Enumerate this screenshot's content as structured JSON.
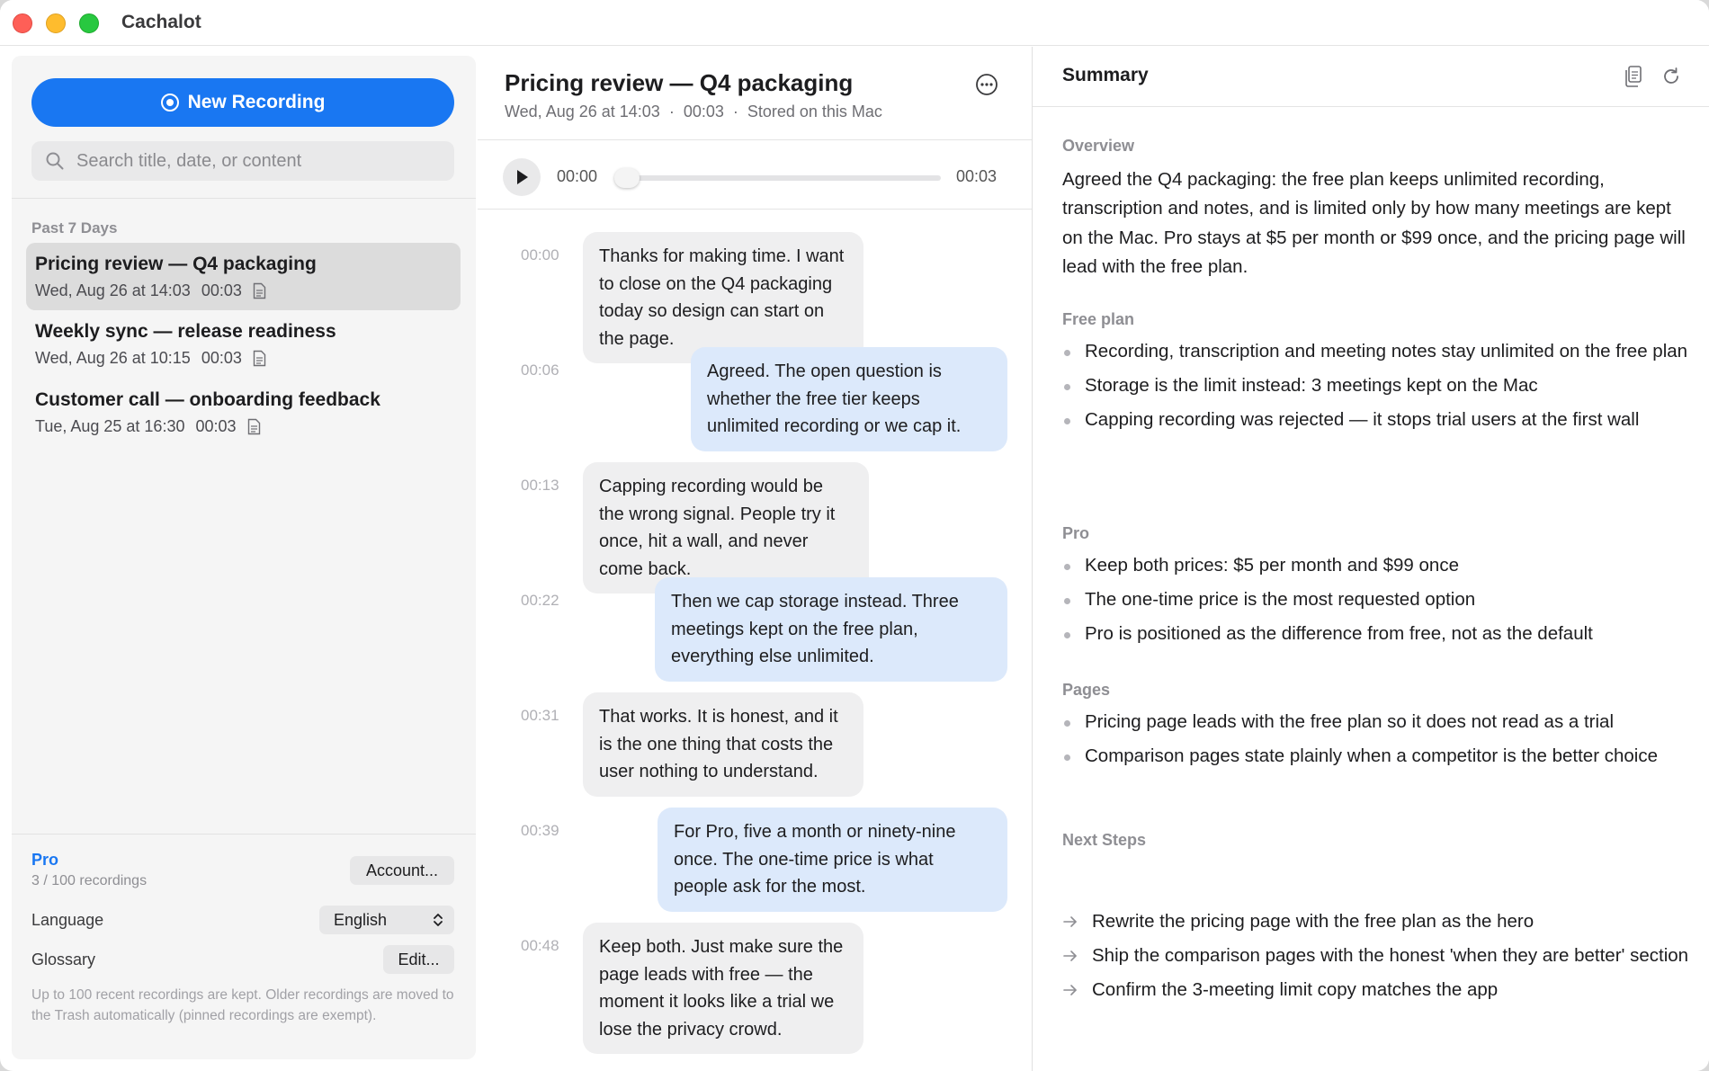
{
  "app": {
    "title": "Cachalot"
  },
  "sidebar": {
    "new_recording_label": "New Recording",
    "search_placeholder": "Search title, date, or content",
    "section_label": "Past 7 Days",
    "recordings": [
      {
        "title": "Pricing review — Q4 packaging",
        "date": "Wed, Aug 26 at 14:03",
        "duration": "00:03",
        "selected": true
      },
      {
        "title": "Weekly sync — release readiness",
        "date": "Wed, Aug 26 at 10:15",
        "duration": "00:03",
        "selected": false
      },
      {
        "title": "Customer call — onboarding feedback",
        "date": "Tue, Aug 25 at 16:30",
        "duration": "00:03",
        "selected": false
      }
    ],
    "plan_label": "Pro",
    "plan_count": "3 / 100 recordings",
    "account_button": "Account...",
    "language_label": "Language",
    "language_value": "English",
    "glossary_label": "Glossary",
    "glossary_button": "Edit...",
    "footnote": "Up to 100 recent recordings are kept. Older recordings are moved to the Trash automatically (pinned recordings are exempt)."
  },
  "transcript": {
    "title": "Pricing review — Q4 packaging",
    "meta_date": "Wed, Aug 26 at 14:03",
    "meta_duration": "00:03",
    "meta_storage": "Stored on this Mac",
    "player": {
      "current": "00:00",
      "total": "00:03",
      "progress": 0.0
    },
    "messages": [
      {
        "time": "00:00",
        "side": "left",
        "text": "Thanks for making time. I want to close on the Q4 packaging today so design can start on the page."
      },
      {
        "time": "00:06",
        "side": "right",
        "text": "Agreed. The open question is whether the free tier keeps unlimited recording or we cap it."
      },
      {
        "time": "00:13",
        "side": "left",
        "text": "Capping recording would be the wrong signal. People try it once, hit a wall, and never come back."
      },
      {
        "time": "00:22",
        "side": "right",
        "text": "Then we cap storage instead. Three meetings kept on the free plan, everything else unlimited."
      },
      {
        "time": "00:31",
        "side": "left",
        "text": "That works. It is honest, and it is the one thing that costs the user nothing to understand."
      },
      {
        "time": "00:39",
        "side": "right",
        "text": "For Pro, five a month or ninety-nine once. The one-time price is what people ask for the most."
      },
      {
        "time": "00:48",
        "side": "left",
        "text": "Keep both. Just make sure the page leads with free — the moment it looks like a trial we lose the privacy crowd."
      }
    ]
  },
  "summary": {
    "title": "Summary",
    "overview_heading": "Overview",
    "overview_text": "Agreed the Q4 packaging: the free plan keeps unlimited recording, transcription and notes, and is limited only by how many meetings are kept on the Mac. Pro stays at $5 per month or $99 once, and the pricing page will lead with the free plan.",
    "free_heading": "Free plan",
    "free_items": [
      "Recording, transcription and meeting notes stay unlimited on the free plan",
      "Storage is the limit instead: 3 meetings kept on the Mac",
      "Capping recording was rejected — it stops trial users at the first wall"
    ],
    "pro_heading": "Pro",
    "pro_items": [
      "Keep both prices: $5 per month and $99 once",
      "The one-time price is the most requested option",
      "Pro is positioned as the difference from free, not as the default"
    ],
    "pages_heading": "Pages",
    "pages_items": [
      "Pricing page leads with the free plan so it does not read as a trial",
      "Comparison pages state plainly when a competitor is the better choice"
    ],
    "steps_heading": "Next Steps",
    "steps_items": [
      "Rewrite the pricing page with the free plan as the hero",
      "Ship the comparison pages with the honest 'when they are better' section",
      "Confirm the 3-meeting limit copy matches the app"
    ]
  },
  "colors": {
    "accent": "#1977f2",
    "bubble_left": "#efeff0",
    "bubble_right": "#dce9fb"
  },
  "icons": [
    "record-icon",
    "search-icon",
    "document-icon",
    "more-icon",
    "play-icon",
    "copy-icon",
    "refresh-icon",
    "arrow-right-icon",
    "updown-chevron-icon"
  ]
}
